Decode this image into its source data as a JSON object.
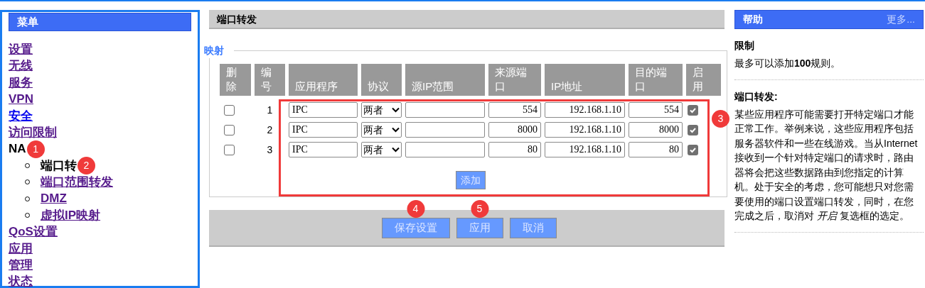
{
  "sidebar": {
    "title": "菜单",
    "items": [
      {
        "label": "设置",
        "kind": "link",
        "visited": true
      },
      {
        "label": "无线",
        "kind": "link",
        "visited": true
      },
      {
        "label": "服务",
        "kind": "link",
        "visited": true
      },
      {
        "label": "VPN",
        "kind": "link",
        "visited": true
      },
      {
        "label": "安全",
        "kind": "link",
        "visited": false
      },
      {
        "label": "访问限制",
        "kind": "link",
        "visited": true
      },
      {
        "label": "NA",
        "kind": "current",
        "badge": "1",
        "children": [
          {
            "label": "端口转",
            "kind": "current",
            "badge": "2"
          },
          {
            "label": "端口范围转发",
            "kind": "link",
            "visited": true
          },
          {
            "label": "DMZ",
            "kind": "link",
            "visited": true
          },
          {
            "label": "虚拟IP映射",
            "kind": "link",
            "visited": true
          }
        ]
      },
      {
        "label": "QoS设置",
        "kind": "link",
        "visited": true
      },
      {
        "label": "应用",
        "kind": "link",
        "visited": true
      },
      {
        "label": "管理",
        "kind": "link",
        "visited": true
      },
      {
        "label": "状态",
        "kind": "link",
        "visited": true
      }
    ]
  },
  "main": {
    "title": "端口转发",
    "legend": "映射",
    "table": {
      "columns": [
        "删除",
        "编号",
        "应用程序",
        "协议",
        "源IP范围",
        "来源端口",
        "IP地址",
        "目的端口",
        "启用"
      ],
      "rows": [
        {
          "delete": false,
          "number": "1",
          "application": "IPC",
          "protocol": "两者",
          "source_ip": "",
          "source_port": "554",
          "ip": "192.168.1.10",
          "dest_port": "554",
          "enabled": true
        },
        {
          "delete": false,
          "number": "2",
          "application": "IPC",
          "protocol": "两者",
          "source_ip": "",
          "source_port": "8000",
          "ip": "192.168.1.10",
          "dest_port": "8000",
          "enabled": true
        },
        {
          "delete": false,
          "number": "3",
          "application": "IPC",
          "protocol": "两者",
          "source_ip": "",
          "source_port": "80",
          "ip": "192.168.1.10",
          "dest_port": "80",
          "enabled": true
        }
      ]
    },
    "add_button": "添加",
    "highlight": {
      "badge": "3"
    },
    "buttons": [
      {
        "label": "保存设置",
        "badge": "4"
      },
      {
        "label": "应用",
        "badge": "5"
      },
      {
        "label": "取消"
      }
    ]
  },
  "help": {
    "title": "帮助",
    "more": "更多...",
    "sections": [
      {
        "heading": "限制",
        "text": "最多可以添加**100**规则。"
      },
      {
        "heading": "端口转发:",
        "text": "某些应用程序可能需要打开特定端口才能正常工作。举例来说，这些应用程序包括服务器软件和一些在线游戏。当从Internet接收到一个针对特定端口的请求时，路由器将会把这些数据路由到您指定的计算机。处于安全的考虑，您可能想只对您需要使用的端口设置端口转发，同时，在您完成之后，取消对 *开启* 复选框的选定。"
      }
    ]
  }
}
